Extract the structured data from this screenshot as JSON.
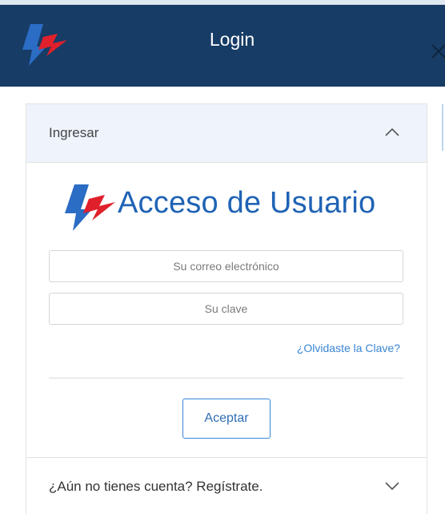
{
  "dialog": {
    "title": "Login",
    "close_icon": "close-icon",
    "logo_icon": "brand-logo-icon",
    "accent_color": "#173c66"
  },
  "login_section": {
    "header_label": "Ingresar",
    "expanded": true,
    "toggle_icon": "chevron-up-icon",
    "brand_text": "Acceso de Usuario",
    "email_placeholder": "Su correo electrónico",
    "password_placeholder": "Su clave",
    "forgot_link": "¿Olvidaste la Clave?",
    "submit_label": "Aceptar"
  },
  "register_section": {
    "header_label": "¿Aún no tienes cuenta? Regístrate.",
    "expanded": false,
    "toggle_icon": "chevron-down-icon"
  },
  "colors": {
    "header_bg": "#173c66",
    "accordion_header_bg": "#eef3fc",
    "link": "#3a86d6",
    "brand_text": "#1f63b5",
    "logo_blue": "#2b6cc4",
    "logo_red": "#e0202b"
  }
}
